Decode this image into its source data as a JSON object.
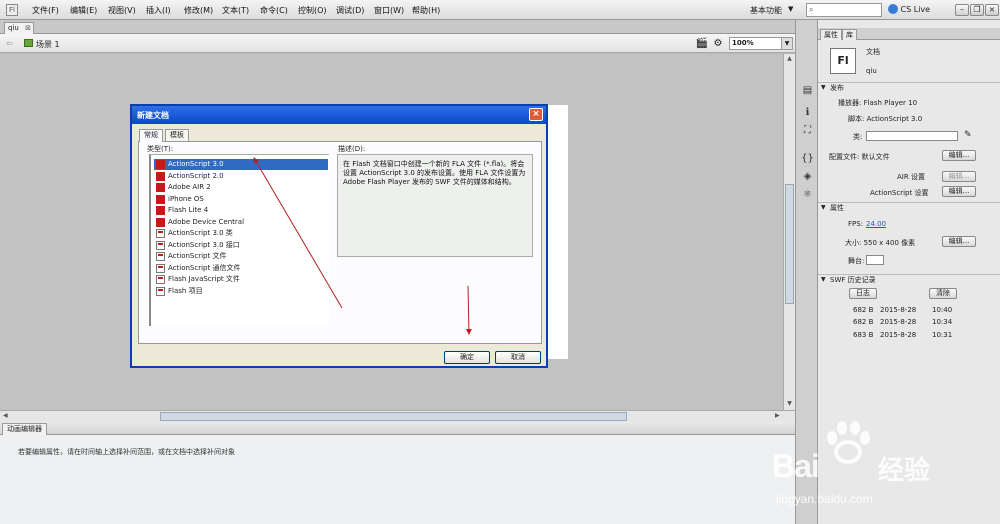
{
  "menubar": {
    "app_icon": "Fl",
    "items": [
      "文件(F)",
      "编辑(E)",
      "视图(V)",
      "插入(I)",
      "修改(M)",
      "文本(T)",
      "命令(C)",
      "控制(O)",
      "调试(D)",
      "窗口(W)",
      "帮助(H)"
    ],
    "workspace": "基本功能",
    "cs_live": "CS Live"
  },
  "document": {
    "tab_name": "qiu",
    "scene": "场景 1",
    "zoom": "100%"
  },
  "dialog": {
    "title": "新建文档",
    "tabs": [
      "常规",
      "模板"
    ],
    "type_label": "类型(T):",
    "types": [
      {
        "label": "ActionScript 3.0",
        "icon": "red"
      },
      {
        "label": "ActionScript 2.0",
        "icon": "red"
      },
      {
        "label": "Adobe AIR 2",
        "icon": "red"
      },
      {
        "label": "iPhone OS",
        "icon": "red"
      },
      {
        "label": "Flash Lite 4",
        "icon": "red"
      },
      {
        "label": "Adobe Device Central",
        "icon": "red"
      },
      {
        "label": "ActionScript 3.0 类",
        "icon": "doc"
      },
      {
        "label": "ActionScript 3.0 接口",
        "icon": "doc"
      },
      {
        "label": "ActionScript 文件",
        "icon": "doc"
      },
      {
        "label": "ActionScript 通信文件",
        "icon": "doc"
      },
      {
        "label": "Flash JavaScript 文件",
        "icon": "doc"
      },
      {
        "label": "Flash 项目",
        "icon": "doc"
      }
    ],
    "description_label": "描述(D):",
    "description": "在 Flash 文档窗口中创建一个新的 FLA 文件 (*.fla)。将会设置 ActionScript 3.0 的发布设置。使用 FLA 文件设置为 Adobe Flash Player 发布的 SWF 文件的媒体和结构。",
    "ok": "确定",
    "cancel": "取消"
  },
  "motion_editor": {
    "tab": "动画编辑器",
    "message": "若要编辑属性，请在时间轴上选择补间范围，或在文档中选择补间对象"
  },
  "properties": {
    "tabs": [
      "属性",
      "库"
    ],
    "doc_icon": "Fl",
    "doc_type": "文档",
    "doc_name": "qiu",
    "publish_section": "发布",
    "player_label": "播放器: Flash Player 10",
    "script_label": "脚本: ActionScript 3.0",
    "class_label": "类:",
    "profile_label": "配置文件: 默认文件",
    "edit": "编辑...",
    "air_label": "AIR 设置",
    "as_label": "ActionScript 设置",
    "props_section": "属性",
    "fps_label": "FPS:",
    "fps_value": "24.00",
    "size_label": "大小: 550 x 400 像素",
    "stage_label": "舞台:",
    "history_section": "SWF 历史记录",
    "log_btn": "日志",
    "clear_btn": "清除",
    "history": [
      {
        "size": "682 B",
        "date": "2015-8-28",
        "time": "10:40"
      },
      {
        "size": "682 B",
        "date": "2015-8-28",
        "time": "10:34"
      },
      {
        "size": "683 B",
        "date": "2015-8-28",
        "time": "10:31"
      }
    ]
  },
  "watermark": {
    "brand": "Bai",
    "brand_cn": "经验",
    "url": "jingyan.baidu.com"
  }
}
